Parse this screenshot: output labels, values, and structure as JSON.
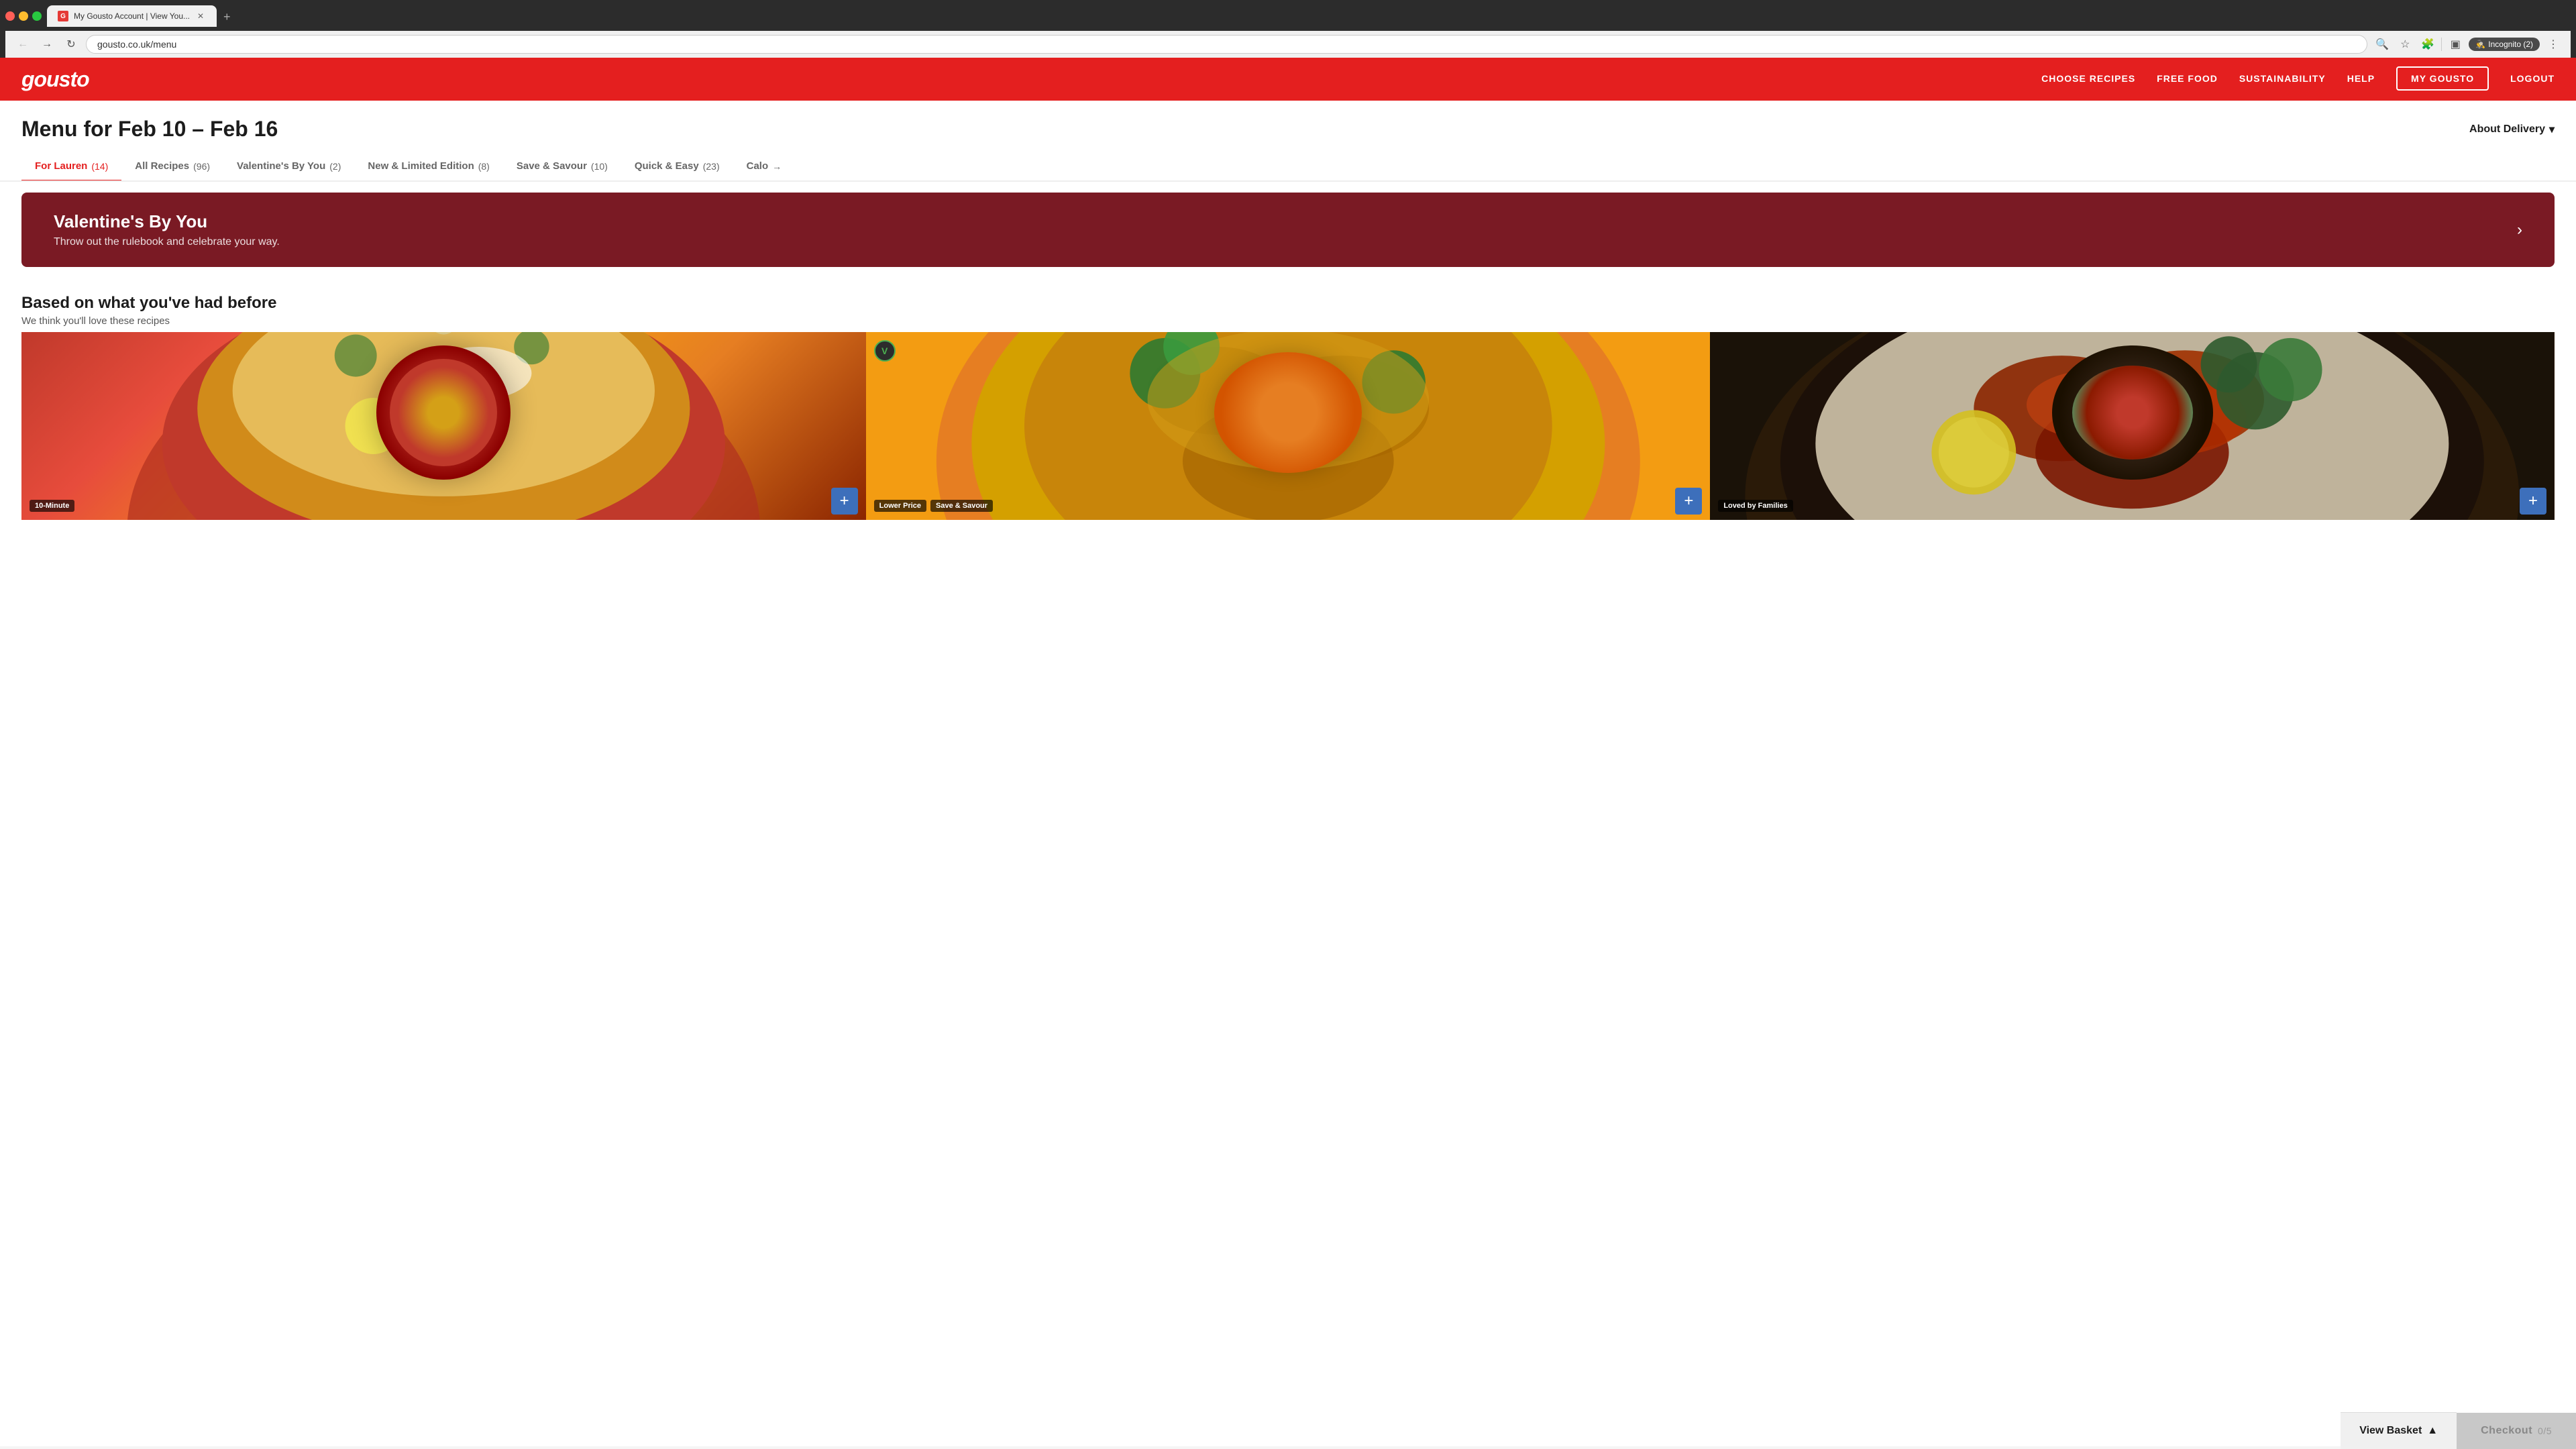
{
  "browser": {
    "tab_title": "My Gousto Account | View You...",
    "tab_favicon": "G",
    "url": "gousto.co.uk/menu",
    "incognito_label": "Incognito (2)"
  },
  "nav": {
    "logo": "gousto",
    "links": [
      {
        "label": "CHOOSE RECIPES",
        "key": "choose-recipes"
      },
      {
        "label": "FREE FOOD",
        "key": "free-food"
      },
      {
        "label": "SUSTAINABILITY",
        "key": "sustainability"
      },
      {
        "label": "HELP",
        "key": "help"
      }
    ],
    "my_gousto": "MY GOUSTO",
    "logout": "LOGOUT"
  },
  "page": {
    "title": "Menu for Feb 10 – Feb 16",
    "about_delivery": "About Delivery"
  },
  "filter_tabs": [
    {
      "label": "For Lauren",
      "count": "(14)",
      "active": true
    },
    {
      "label": "All Recipes",
      "count": "(96)",
      "active": false
    },
    {
      "label": "Valentine's By You",
      "count": "(2)",
      "active": false
    },
    {
      "label": "New & Limited Edition",
      "count": "(8)",
      "active": false
    },
    {
      "label": "Save & Savour",
      "count": "(10)",
      "active": false
    },
    {
      "label": "Quick & Easy",
      "count": "(23)",
      "active": false
    },
    {
      "label": "Calo",
      "count": "→",
      "active": false
    }
  ],
  "banner": {
    "title": "Valentine's By You",
    "subtitle": "Throw out the rulebook and celebrate your way."
  },
  "section": {
    "heading": "Based on what you've had before",
    "subheading": "We think you'll love these recipes"
  },
  "recipes": [
    {
      "id": 1,
      "badge_label": "10-Minute",
      "badge_type": "dark",
      "dish_class": "dish-1",
      "has_vegetarian": false
    },
    {
      "id": 2,
      "badge_label": "Lower Price",
      "badge_label_2": "Save & Savour",
      "badge_type": "dark",
      "dish_class": "dish-2",
      "has_vegetarian": true
    },
    {
      "id": 3,
      "badge_label": "Loved by Families",
      "badge_type": "dark",
      "dish_class": "dish-3",
      "has_vegetarian": false
    }
  ],
  "bottom_bar": {
    "view_basket": "View Basket",
    "checkout": "Checkout",
    "progress": "0/5"
  }
}
